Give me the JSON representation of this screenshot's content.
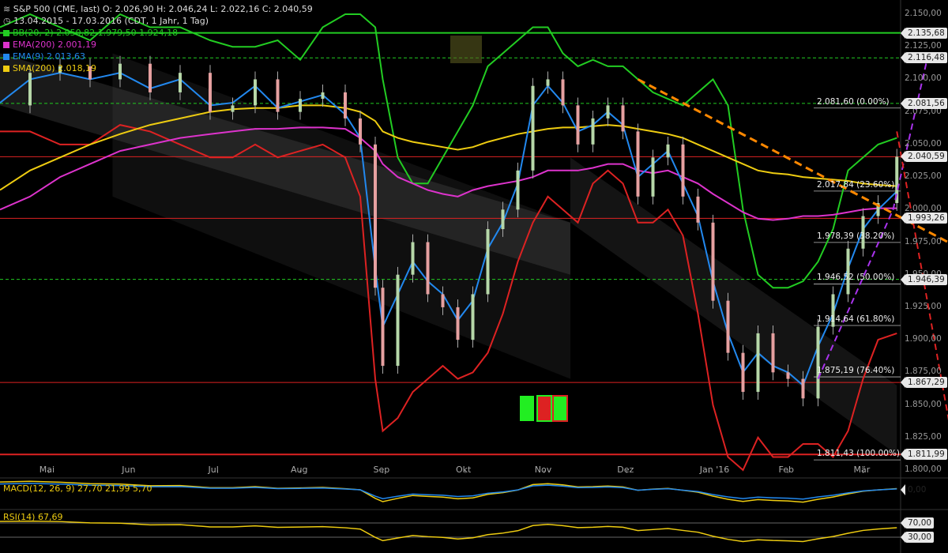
{
  "header": {
    "symbol_line": "S&P 500 (CME, last)  O: 2.026,90  H: 2.046,24  L: 2.022,16  C: 2.040,59",
    "period_line": "13.04.2015 - 17.03.2016 (CDT, 1 Jahr, 1 Tag)"
  },
  "indicators": [
    {
      "label": "BB(20, 2)",
      "values": "2.050,82  1.979,50  1.924,18",
      "color": "#22cc22"
    },
    {
      "label": "EMA(200)",
      "values": "2.001,19",
      "color": "#dd33cc"
    },
    {
      "label": "EMA(9)",
      "values": "2.013,63",
      "color": "#2288ee"
    },
    {
      "label": "SMA(200)",
      "values": "2.018,19",
      "color": "#eecc11"
    }
  ],
  "price_tags": [
    {
      "label": "2.135,68",
      "value": 2135.68,
      "line_color": "#22cc22"
    },
    {
      "label": "2.116,48",
      "value": 2116.48,
      "line_color": "#22cc22"
    },
    {
      "label": "2.081,56",
      "value": 2081.56,
      "line_color": "#22cc22"
    },
    {
      "label": "2.040,59",
      "value": 2040.59,
      "line_color": "#dd2222"
    },
    {
      "label": "1.993,26",
      "value": 1993.26,
      "line_color": "#dd2222"
    },
    {
      "label": "1.946,39",
      "value": 1946.39,
      "line_color": "#22cc22"
    },
    {
      "label": "1.867,29",
      "value": 1867.29,
      "line_color": "#dd2222"
    },
    {
      "label": "1.811,99",
      "value": 1811.99,
      "line_color": "#dd2222"
    }
  ],
  "fib_levels": [
    {
      "label": "2.081,60 (0.00%)",
      "value": 2081.6
    },
    {
      "label": "2.017,84 (23.60%)",
      "value": 2017.84
    },
    {
      "label": "1.978,39 (38.20%)",
      "value": 1978.39
    },
    {
      "label": "1.946,52 (50.00%)",
      "value": 1946.52
    },
    {
      "label": "1.914,64 (61.80%)",
      "value": 1914.64
    },
    {
      "label": "1.875,19 (76.40%)",
      "value": 1875.19
    },
    {
      "label": "1.811,43 (100.00%)",
      "value": 1811.43
    }
  ],
  "chart_data": {
    "type": "candlestick",
    "y_ticks": [
      "2.150,00",
      "2.125,00",
      "2.100,00",
      "2.075,00",
      "2.050,00",
      "2.025,00",
      "2.000,00",
      "1.975,00",
      "1.950,00",
      "1.925,00",
      "1.900,00",
      "1.875,00",
      "1.850,00",
      "1.825,00",
      "1.800,00"
    ],
    "y_tick_values": [
      2150,
      2125,
      2100,
      2075,
      2050,
      2025,
      2000,
      1975,
      1950,
      1925,
      1900,
      1875,
      1850,
      1825,
      1800
    ],
    "ylim": [
      1800,
      2150
    ],
    "x_labels": [
      "Mai",
      "Jun",
      "Jul",
      "Aug",
      "Sep",
      "Okt",
      "Nov",
      "Dez",
      "Jan '16",
      "Feb",
      "Mär"
    ],
    "x_label_day": [
      13,
      35,
      58,
      80,
      102,
      124,
      145,
      167,
      189,
      210,
      230
    ],
    "trading_days": 240,
    "series": [
      {
        "name": "S&P 500",
        "days": [
          0,
          8,
          16,
          24,
          32,
          40,
          48,
          56,
          62,
          68,
          74,
          80,
          86,
          92,
          96,
          100,
          102,
          106,
          110,
          114,
          118,
          122,
          126,
          130,
          134,
          138,
          142,
          146,
          150,
          154,
          158,
          162,
          166,
          170,
          174,
          178,
          182,
          186,
          190,
          194,
          198,
          202,
          206,
          210,
          214,
          218,
          222,
          226,
          230,
          234,
          239
        ],
        "close": [
          2080,
          2105,
          2110,
          2100,
          2112,
          2090,
          2105,
          2075,
          2080,
          2100,
          2075,
          2085,
          2090,
          2070,
          2050,
          1940,
          1880,
          1950,
          1975,
          1935,
          1925,
          1900,
          1935,
          1985,
          2000,
          2030,
          2095,
          2100,
          2080,
          2050,
          2070,
          2080,
          2060,
          2010,
          2040,
          2050,
          2010,
          1990,
          1930,
          1890,
          1860,
          1905,
          1875,
          1870,
          1855,
          1910,
          1935,
          1970,
          1995,
          2005,
          2040.59
        ]
      },
      {
        "name": "BB(20, 2)",
        "upper": [
          2140,
          2150,
          2140,
          2130,
          2150,
          2140,
          2140,
          2130,
          2125,
          2125,
          2130,
          2115,
          2140,
          2150,
          2150,
          2140,
          2100,
          2040,
          2020,
          2020,
          2040,
          2060,
          2080,
          2110,
          2120,
          2130,
          2140,
          2140,
          2120,
          2110,
          2115,
          2110,
          2110,
          2100,
          2090,
          2085,
          2080,
          2090,
          2100,
          2080,
          2000,
          1950,
          1940,
          1940,
          1945,
          1960,
          1985,
          2030,
          2040,
          2050,
          2055
        ],
        "lower": [
          2060,
          2060,
          2050,
          2050,
          2065,
          2060,
          2050,
          2040,
          2040,
          2050,
          2040,
          2045,
          2050,
          2040,
          2010,
          1870,
          1830,
          1840,
          1860,
          1870,
          1880,
          1870,
          1875,
          1890,
          1920,
          1960,
          1990,
          2010,
          2000,
          1990,
          2020,
          2030,
          2020,
          1990,
          1990,
          2000,
          1980,
          1920,
          1850,
          1810,
          1800,
          1825,
          1810,
          1810,
          1820,
          1820,
          1810,
          1830,
          1870,
          1900,
          1905
        ]
      },
      {
        "name": "EMA(200)",
        "values": [
          2000,
          2010,
          2025,
          2035,
          2045,
          2050,
          2055,
          2058,
          2060,
          2062,
          2062,
          2063,
          2063,
          2062,
          2055,
          2045,
          2035,
          2025,
          2020,
          2015,
          2012,
          2010,
          2015,
          2018,
          2020,
          2022,
          2025,
          2030,
          2030,
          2030,
          2032,
          2035,
          2035,
          2030,
          2028,
          2030,
          2025,
          2020,
          2012,
          2005,
          1998,
          1993,
          1992,
          1993,
          1995,
          1995,
          1996,
          1998,
          2000,
          2001,
          2001
        ]
      },
      {
        "name": "SMA(200)",
        "values": [
          2015,
          2030,
          2040,
          2050,
          2058,
          2065,
          2070,
          2075,
          2077,
          2078,
          2078,
          2080,
          2080,
          2078,
          2075,
          2068,
          2060,
          2055,
          2052,
          2050,
          2048,
          2046,
          2048,
          2052,
          2055,
          2058,
          2060,
          2062,
          2063,
          2063,
          2064,
          2065,
          2064,
          2062,
          2060,
          2058,
          2055,
          2050,
          2045,
          2040,
          2035,
          2030,
          2028,
          2027,
          2025,
          2024,
          2023,
          2022,
          2020,
          2019,
          2018
        ]
      },
      {
        "name": "EMA(9)",
        "values": [
          2082,
          2100,
          2105,
          2100,
          2105,
          2093,
          2100,
          2080,
          2082,
          2095,
          2078,
          2083,
          2088,
          2073,
          2055,
          1955,
          1910,
          1935,
          1960,
          1945,
          1935,
          1915,
          1930,
          1970,
          1990,
          2020,
          2080,
          2095,
          2082,
          2060,
          2065,
          2075,
          2065,
          2025,
          2035,
          2045,
          2020,
          1995,
          1945,
          1905,
          1875,
          1890,
          1880,
          1875,
          1865,
          1895,
          1920,
          1955,
          1985,
          2000,
          2014
        ]
      }
    ]
  },
  "macd": {
    "label": "MACD(12, 26, 9)",
    "values": "27,70  21,99  5,70",
    "ylabel": "0,00"
  },
  "rsi": {
    "label": "RSI(14)",
    "value": "67,69",
    "levels": [
      "70,00",
      "30,00"
    ]
  }
}
